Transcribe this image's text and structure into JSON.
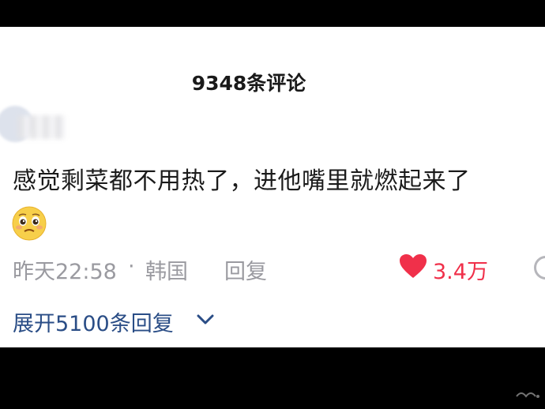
{
  "header": {
    "comment_count_title": "9348条评论"
  },
  "comment": {
    "text": "感觉剩菜都不用热了，进他嘴里就燃起来了",
    "emoji": "pleading-face-emoji",
    "time": "昨天22:58",
    "separator": "·",
    "region": "韩国",
    "reply_label": "回复",
    "likes": "3.4万"
  },
  "expand_replies_label": "展开5100条回复",
  "colors": {
    "like_red": "#f0304a",
    "link_blue": "#2a4d86",
    "meta_gray": "#9a9aa0"
  }
}
